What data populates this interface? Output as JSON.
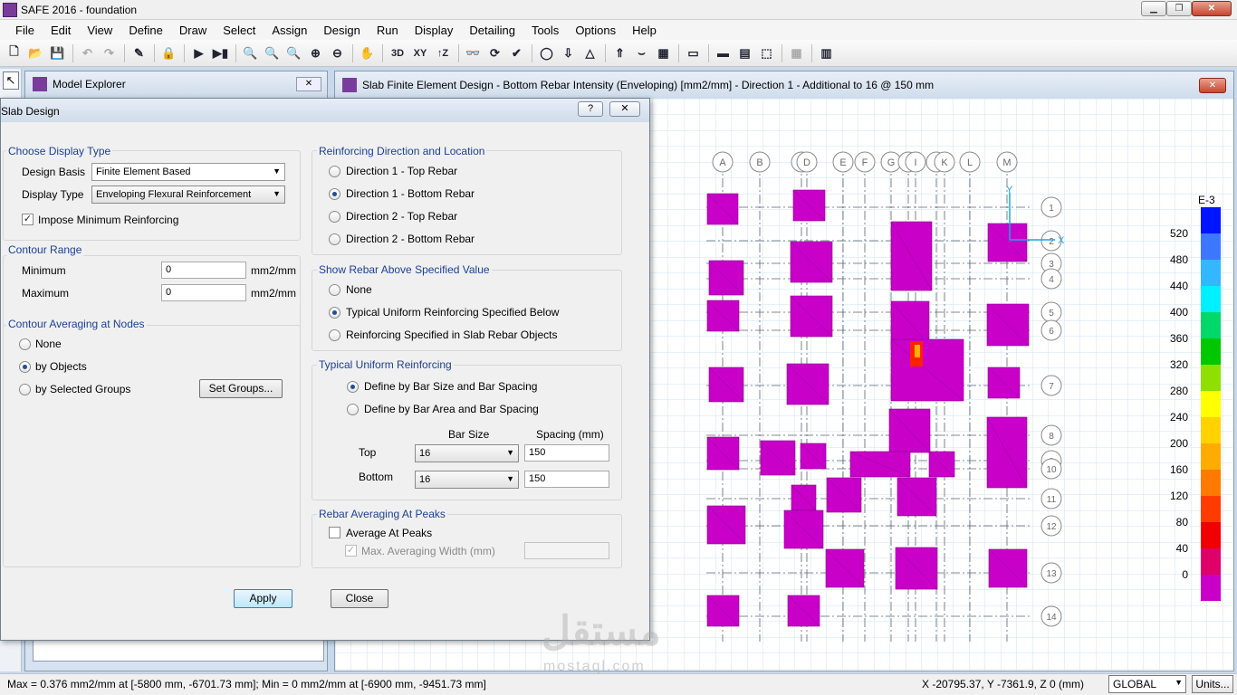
{
  "window": {
    "title": "SAFE 2016 - foundation"
  },
  "menu": [
    "File",
    "Edit",
    "View",
    "Define",
    "Draw",
    "Select",
    "Assign",
    "Design",
    "Run",
    "Display",
    "Detailing",
    "Tools",
    "Options",
    "Help"
  ],
  "toolbar": {
    "view_3d": "3D",
    "view_xy": "XY",
    "view_z": "↑Z"
  },
  "explorer": {
    "title": "Model Explorer"
  },
  "slab_window": {
    "title": "Slab Finite Element Design - Bottom Rebar Intensity (Enveloping) [mm2/mm] - Direction 1 - Additional to 16 @ 150 mm"
  },
  "dialog": {
    "title": "Slab Design",
    "help": "?",
    "close_x": "✕",
    "display_type": {
      "title": "Choose Display Type",
      "design_basis_label": "Design Basis",
      "design_basis_value": "Finite Element Based",
      "display_type_label": "Display Type",
      "display_type_value": "Enveloping Flexural Reinforcement",
      "impose_min_label": "Impose Minimum Reinforcing"
    },
    "contour_range": {
      "title": "Contour Range",
      "min_label": "Minimum",
      "min_value": "0",
      "max_label": "Maximum",
      "max_value": "0",
      "unit": "mm2/mm"
    },
    "averaging": {
      "title": "Contour Averaging at Nodes",
      "none": "None",
      "by_objects": "by Objects",
      "by_groups": "by Selected Groups",
      "set_groups": "Set Groups..."
    },
    "direction": {
      "title": "Reinforcing Direction and Location",
      "opt1": "Direction 1  -  Top Rebar",
      "opt2": "Direction 1  -  Bottom Rebar",
      "opt3": "Direction 2  -  Top Rebar",
      "opt4": "Direction 2  -  Bottom Rebar"
    },
    "show_rebar": {
      "title": "Show Rebar Above Specified Value",
      "none": "None",
      "typical": "Typical Uniform Reinforcing Specified Below",
      "slab_rebar": "Reinforcing Specified in Slab Rebar Objects"
    },
    "typical": {
      "title": "Typical Uniform Reinforcing",
      "by_size": "Define by Bar Size and Bar Spacing",
      "by_area": "Define by Bar Area and Bar Spacing",
      "bar_size_hdr": "Bar Size",
      "spacing_hdr": "Spacing  (mm)",
      "top_label": "Top",
      "top_size": "16",
      "top_spacing": "150",
      "bottom_label": "Bottom",
      "bottom_size": "16",
      "bottom_spacing": "150"
    },
    "peaks": {
      "title": "Rebar Averaging At Peaks",
      "average": "Average At Peaks",
      "max_width": "Max. Averaging Width  (mm)"
    },
    "apply": "Apply",
    "close": "Close"
  },
  "plot": {
    "grid_x": [
      "A",
      "B",
      "C",
      "D",
      "E",
      "F",
      "G",
      "H",
      "I",
      "J",
      "K",
      "L",
      "M"
    ],
    "grid_y": [
      "1",
      "2",
      "3",
      "4",
      "5",
      "6",
      "7",
      "8",
      "9",
      "10",
      "11",
      "12",
      "13",
      "14"
    ],
    "axis_x": "X",
    "axis_y": "Y",
    "legend_title": "E-3",
    "legend_values": [
      "520",
      "480",
      "440",
      "400",
      "360",
      "320",
      "280",
      "240",
      "200",
      "160",
      "120",
      "80",
      "40",
      "0"
    ],
    "legend_colors": [
      "#0015ff",
      "#3c78ff",
      "#33b7ff",
      "#00f0ff",
      "#00d86a",
      "#00c800",
      "#8ee000",
      "#ffff00",
      "#ffd200",
      "#ffac00",
      "#ff7a00",
      "#ff3c00",
      "#f00000",
      "#e0006a",
      "#c800c8"
    ],
    "footing_color": "#c800c8",
    "peak_color": "#ff2000"
  },
  "status": {
    "minmax": "Max = 0.376 mm2/mm at [-5800 mm, -6701.73 mm];  Min = 0 mm2/mm at [-6900 mm, -9451.73 mm]",
    "coords": "X -20795.37,  Y -7361.9,  Z 0   (mm)",
    "global": "GLOBAL",
    "units": "Units..."
  },
  "watermark": {
    "main": "مستقل",
    "sub": "mostaql.com"
  }
}
